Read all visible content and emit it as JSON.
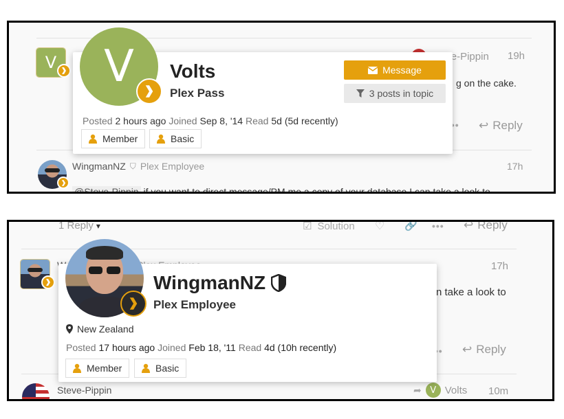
{
  "panel1": {
    "post": {
      "author_initial": "V",
      "reply_to_name": "Steve-Pippin",
      "time": "19h",
      "body_snippet": "g on the cake.",
      "reply_label": "Reply"
    },
    "card": {
      "initial": "V",
      "name": "Volts",
      "title": "Plex Pass",
      "message_label": "Message",
      "posts_label": "3 posts in topic",
      "posted_key": "Posted",
      "posted_val": "2 hours ago",
      "joined_key": "Joined",
      "joined_val": "Sep 8, '14",
      "read_key": "Read",
      "read_val": "5d (5d recently)",
      "groups": [
        "Member",
        "Basic"
      ]
    },
    "next_post": {
      "name": "WingmanNZ",
      "role": "Plex Employee",
      "time": "17h",
      "mention": "@Steve-Pippin",
      "body": " if you want to direct message/PM me a copy of your database I can take a look to"
    }
  },
  "panel2": {
    "top_row": {
      "reply_count": "1 Reply",
      "solution_label": "Solution",
      "reply_label": "Reply"
    },
    "post": {
      "name_fragment": "W",
      "role_fragment": "Plex Employee",
      "time": "17h",
      "body_snippet": "n take a look to",
      "reply_label": "Reply"
    },
    "annotation": "?",
    "card": {
      "name": "WingmanNZ",
      "title": "Plex Employee",
      "location": "New Zealand",
      "posted_key": "Posted",
      "posted_val": "17 hours ago",
      "joined_key": "Joined",
      "joined_val": "Feb 18, '11",
      "read_key": "Read",
      "read_val": "4d (10h recently)",
      "groups": [
        "Member",
        "Basic"
      ]
    },
    "bottom_post": {
      "name": "Steve-Pippin",
      "reply_to_initial": "V",
      "reply_to_name": "Volts",
      "time": "10m"
    }
  },
  "colors": {
    "accent": "#e5a00d",
    "avatar_green": "#9ab35a",
    "annotation_red": "#d62020"
  }
}
